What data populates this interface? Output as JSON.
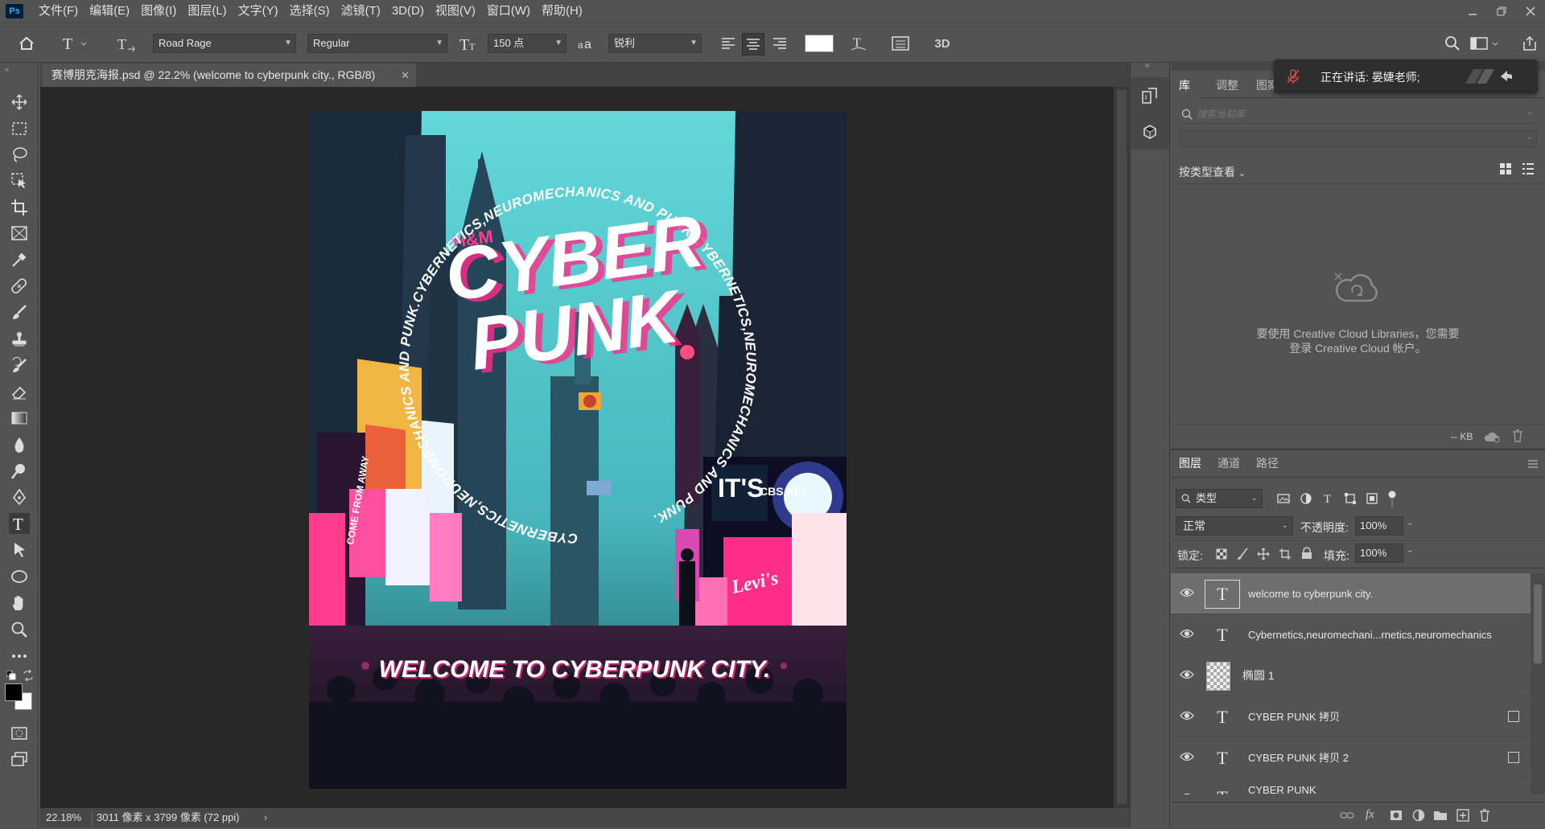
{
  "app": {
    "logo": "Ps"
  },
  "menu": [
    "文件(F)",
    "编辑(E)",
    "图像(I)",
    "图层(L)",
    "文字(Y)",
    "选择(S)",
    "滤镜(T)",
    "3D(D)",
    "视图(V)",
    "窗口(W)",
    "帮助(H)"
  ],
  "options": {
    "font_family": "Road Rage",
    "font_style": "Regular",
    "font_size": "150 点",
    "antialias": "锐利",
    "text_color": "#ffffff"
  },
  "document": {
    "tab_title": "赛博朋克海报.psd @ 22.2% (welcome to cyberpunk city., RGB/8)",
    "zoom": "22.18%",
    "info": "3011 像素 x 3799 像素 (72 ppi)"
  },
  "poster": {
    "title_line1": "CYBER",
    "title_line2": "PUNK",
    "arc_text": "CYBERNETICS,NEUROMECHANICS AND PUNK.CYBERNETICS,NEUROMECHANICS AND PUNK.CYBERNETICS,NEUROMECHANICS AND PUNK.",
    "bottom_text": "WELCOME TO CYBERPUNK CITY.",
    "sign_hm": "H&M",
    "sign_levis": "Levi's",
    "sign_its": "IT'S",
    "sign_cbs": "CBS ALL",
    "sign_come": "COME FROM AWAY",
    "colors": {
      "sky": "#5fd3d4",
      "accent": "#ff2d8a",
      "dark": "#0e1a2a"
    }
  },
  "toast": {
    "text": "正在讲话: 晏婕老师;"
  },
  "library": {
    "tabs": [
      "库",
      "调整",
      "图案"
    ],
    "search_placeholder": "搜索当前库",
    "view_by": "按类型查看",
    "message_line1": "要使用 Creative Cloud Libraries，您需要",
    "message_line2": "登录 Creative Cloud 帐户。",
    "size": "-- KB"
  },
  "layers_panel": {
    "tabs": [
      "图层",
      "通道",
      "路径"
    ],
    "filter": "类型",
    "blend_mode": "正常",
    "opacity_label": "不透明度:",
    "opacity": "100%",
    "lock_label": "锁定:",
    "fill_label": "填充:",
    "fill": "100%",
    "layers": [
      {
        "name": "welcome to cyberpunk city.",
        "kind": "text",
        "selected": true
      },
      {
        "name": "Cybernetics,neuromechani...rnetics,neuromechanics",
        "kind": "text",
        "selected": false
      },
      {
        "name": "椭圆 1",
        "kind": "shape",
        "selected": false
      },
      {
        "name": "CYBER PUNK 拷贝",
        "kind": "text",
        "smart": true
      },
      {
        "name": "CYBER PUNK 拷贝 2",
        "kind": "text",
        "smart": true
      },
      {
        "name": "CYBER PUNK",
        "kind": "text",
        "smart": false
      }
    ]
  }
}
